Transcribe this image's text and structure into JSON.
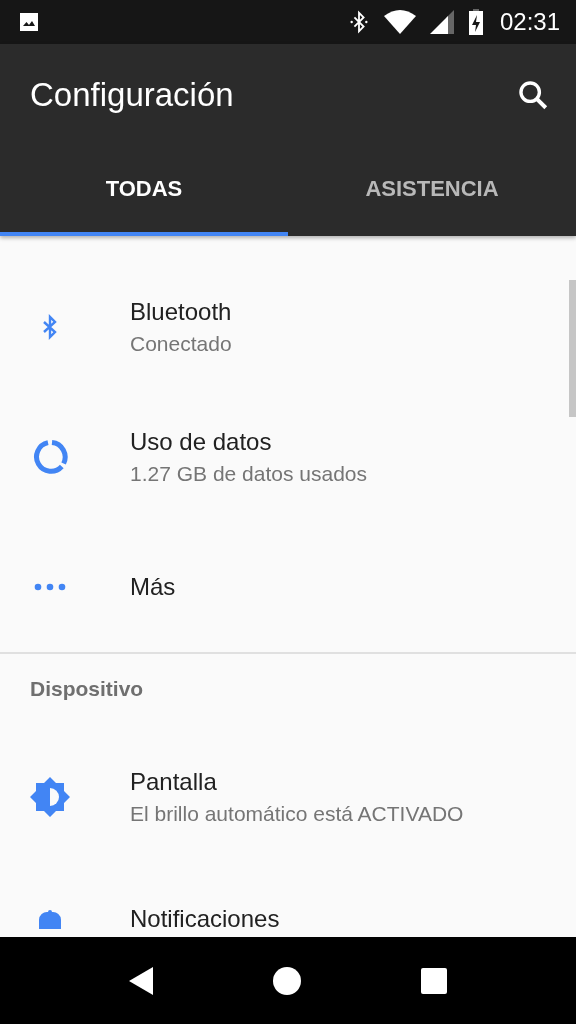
{
  "status_bar": {
    "time": "02:31"
  },
  "app_bar": {
    "title": "Configuración"
  },
  "tabs": [
    {
      "label": "TODAS",
      "selected": true
    },
    {
      "label": "ASISTENCIA",
      "selected": false
    }
  ],
  "sections": [
    {
      "items": [
        {
          "kind": "bluetooth",
          "title": "Bluetooth",
          "subtitle": "Conectado"
        },
        {
          "kind": "data",
          "title": "Uso de datos",
          "subtitle": "1.27 GB de datos usados"
        },
        {
          "kind": "more",
          "title": "Más"
        }
      ]
    },
    {
      "header": "Dispositivo",
      "items": [
        {
          "kind": "display",
          "title": "Pantalla",
          "subtitle": "El brillo automático está ACTIVADO"
        },
        {
          "kind": "notifications",
          "title": "Notificaciones"
        }
      ]
    }
  ]
}
